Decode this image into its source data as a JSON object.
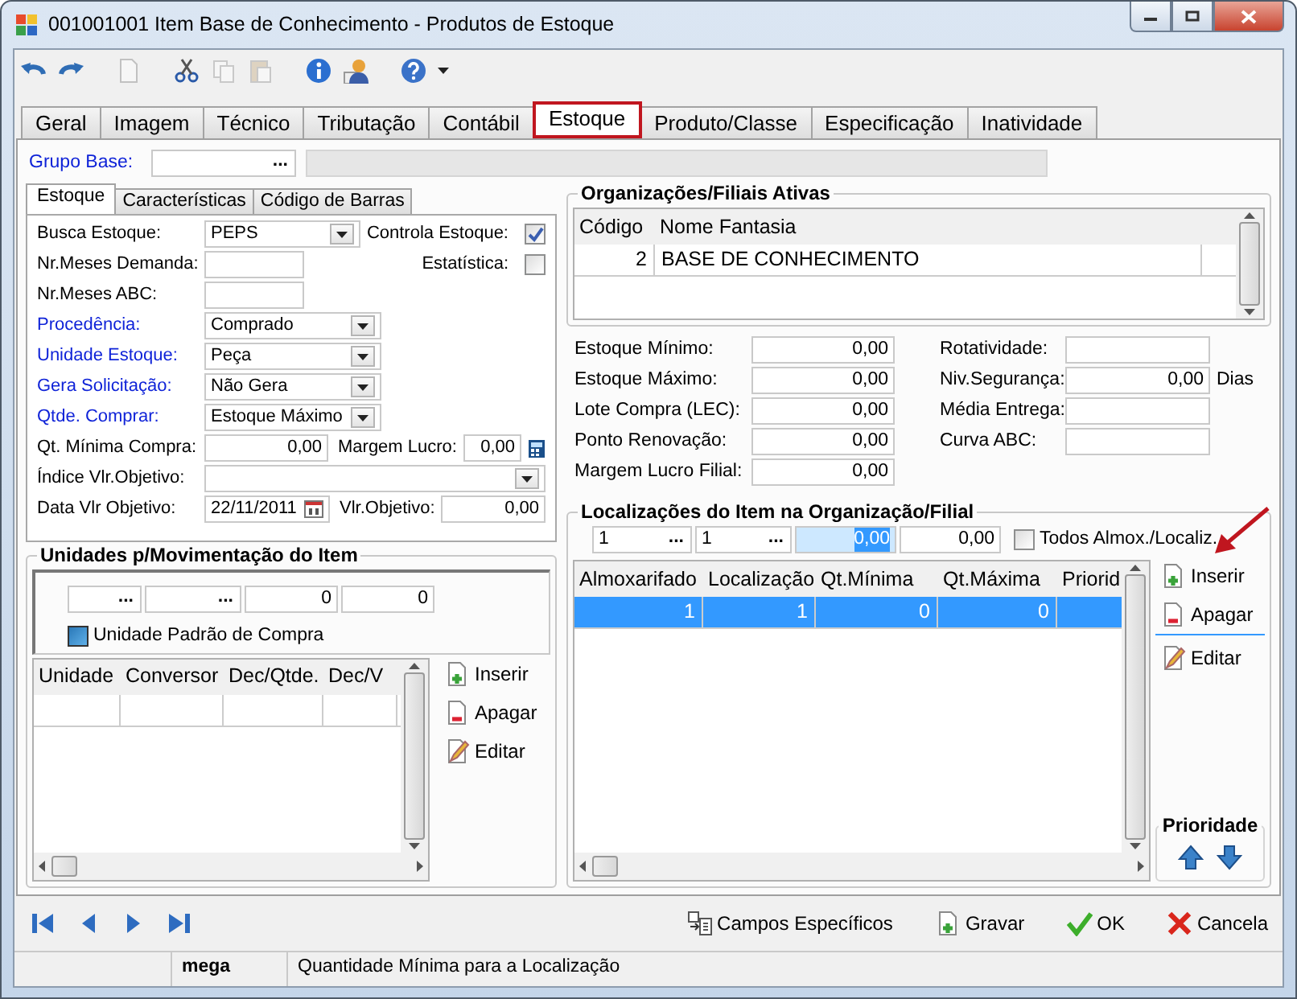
{
  "window": {
    "title": "001001001 Item Base de Conhecimento -  Produtos de Estoque"
  },
  "toolbar": [
    {
      "kind": "undo",
      "disabled": false
    },
    {
      "kind": "redo",
      "disabled": false
    },
    {
      "kind": "sep"
    },
    {
      "kind": "new",
      "disabled": true
    },
    {
      "kind": "sep"
    },
    {
      "kind": "cut",
      "disabled": false
    },
    {
      "kind": "copy",
      "disabled": true
    },
    {
      "kind": "paste",
      "disabled": true
    },
    {
      "kind": "sep"
    },
    {
      "kind": "info",
      "disabled": false
    },
    {
      "kind": "user",
      "disabled": false
    },
    {
      "kind": "sep"
    },
    {
      "kind": "help",
      "disabled": false
    }
  ],
  "tabs": [
    {
      "label": "Geral",
      "selected": false,
      "highlighted": false
    },
    {
      "label": "Imagem",
      "selected": false,
      "highlighted": false
    },
    {
      "label": "Técnico",
      "selected": false,
      "highlighted": false
    },
    {
      "label": "Tributação",
      "selected": false,
      "highlighted": false
    },
    {
      "label": "Contábil",
      "selected": false,
      "highlighted": false
    },
    {
      "label": "Estoque",
      "selected": true,
      "highlighted": true
    },
    {
      "label": "Produto/Classe",
      "selected": false,
      "highlighted": false
    },
    {
      "label": "Especificação",
      "selected": false,
      "highlighted": false
    },
    {
      "label": "Inatividade",
      "selected": false,
      "highlighted": false
    }
  ],
  "grupo_base": {
    "label": "Grupo Base:",
    "required": true,
    "button": "..."
  },
  "left_tabs": [
    {
      "label": "Estoque",
      "selected": true
    },
    {
      "label": "Características",
      "selected": false
    },
    {
      "label": "Código de Barras",
      "selected": false
    }
  ],
  "estoque_rows": [
    [
      {
        "kind": "select",
        "label": "Busca Estoque:",
        "value": "PEPS",
        "required": false
      },
      {
        "kind": "checkbox",
        "label": "Controla Estoque:",
        "checked": true
      }
    ],
    [
      {
        "kind": "text",
        "label": "Nr.Meses Demanda:",
        "required": false
      },
      {
        "kind": "checkbox",
        "label": "Estatística:",
        "checked": false
      }
    ],
    [
      {
        "kind": "text",
        "label": "Nr.Meses ABC:",
        "required": false
      }
    ],
    [
      {
        "kind": "select",
        "label": "Procedência:",
        "value": "Comprado",
        "required": true
      }
    ],
    [
      {
        "kind": "select",
        "label": "Unidade Estoque:",
        "value": "Peça",
        "required": true
      }
    ],
    [
      {
        "kind": "select",
        "label": "Gera Solicitação:",
        "value": "Não Gera",
        "required": true
      }
    ],
    [
      {
        "kind": "select",
        "label": "Qtde. Comprar:",
        "value": "Estoque Máximo",
        "required": true
      }
    ],
    [
      {
        "kind": "number",
        "label": "Qt. Mínima Compra:",
        "value": "0,00",
        "required": false
      },
      {
        "kind": "calc",
        "label": "Margem Lucro:",
        "value": "0,00",
        "required": false
      }
    ],
    [
      {
        "kind": "wide-select",
        "label": "Índice Vlr.Objetivo:",
        "required": false
      }
    ],
    [
      {
        "kind": "date",
        "label": "Data Vlr Objetivo:",
        "value": "22/11/2011",
        "required": false
      },
      {
        "kind": "number",
        "label": "Vlr.Objetivo:",
        "value": "0,00",
        "required": false
      }
    ]
  ],
  "unidades": {
    "title": "Unidades p/Movimentação do Item",
    "inputs": [
      {
        "kind": "lookup",
        "button": "..."
      },
      {
        "kind": "lookup",
        "button": "..."
      },
      {
        "kind": "number",
        "value": "0",
        "focused": false
      },
      {
        "kind": "number",
        "value": "0",
        "focused": false
      }
    ],
    "checkbox": {
      "label": "Unidade Padrão de Compra",
      "checked": true
    },
    "table": {
      "columns": [
        "Unidade",
        "Conversor",
        "Dec/Qtde.",
        "Dec/V"
      ]
    },
    "buttons": [
      {
        "kind": "insert",
        "label": "Inserir",
        "marked": false
      },
      {
        "kind": "delete",
        "label": "Apagar",
        "marked": false
      },
      {
        "kind": "edit",
        "label": "Editar",
        "marked": false
      }
    ]
  },
  "organizacoes": {
    "title": "Organizações/Filiais Ativas",
    "columns": [
      "Código",
      "Nome Fantasia"
    ],
    "rows": [
      {
        "cells": [
          "2",
          "BASE DE CONHECIMENTO"
        ],
        "selected": false
      }
    ]
  },
  "estoque_filial": {
    "left": [
      {
        "label": "Estoque Mínimo:",
        "value": "0,00"
      },
      {
        "label": "Estoque Máximo:",
        "value": "0,00"
      },
      {
        "label": "Lote Compra (LEC):",
        "value": "0,00"
      },
      {
        "label": "Ponto Renovação:",
        "value": "0,00"
      },
      {
        "label": "Margem Lucro Filial:",
        "value": "0,00"
      }
    ],
    "right": [
      {
        "label": "Rotatividade:"
      },
      {
        "label": "Niv.Segurança:",
        "value": "0,00",
        "suffix": "Dias"
      },
      {
        "label": "Média Entrega:"
      },
      {
        "label": "Curva ABC:"
      }
    ]
  },
  "localizacoes": {
    "title": "Localizações do Item na Organização/Filial",
    "inputs": [
      {
        "kind": "lookup",
        "value": "1",
        "button": "..."
      },
      {
        "kind": "lookup",
        "value": "1",
        "button": "..."
      },
      {
        "kind": "number",
        "value": "0,00",
        "focused": true
      },
      {
        "kind": "number",
        "value": "0,00",
        "focused": false
      }
    ],
    "checkbox": {
      "label": "Todos Almox./Localiz.",
      "checked": false
    },
    "table": {
      "columns": [
        "Almoxarifado",
        "Localização",
        "Qt.Mínima",
        "Qt.Máxima",
        "Priorid"
      ],
      "rows": [
        {
          "cells": [
            "1",
            "1",
            "0",
            "0"
          ],
          "selected": true
        }
      ]
    },
    "buttons": [
      {
        "kind": "insert",
        "label": "Inserir",
        "marked": true
      },
      {
        "kind": "delete",
        "label": "Apagar",
        "marked": false
      },
      {
        "kind": "edit",
        "label": "Editar",
        "marked": false
      }
    ],
    "priority": {
      "title": "Prioridade"
    }
  },
  "navigation": [
    {
      "kind": "first"
    },
    {
      "kind": "prev"
    },
    {
      "kind": "next"
    },
    {
      "kind": "last"
    }
  ],
  "actions": [
    {
      "kind": "fields",
      "label": "Campos Específicos"
    },
    {
      "kind": "save",
      "label": "Gravar"
    },
    {
      "kind": "ok",
      "label": "OK"
    },
    {
      "kind": "cancel",
      "label": "Cancela"
    }
  ],
  "status_bar": {
    "user": "mega",
    "message": "Quantidade Mínima para a Localização"
  }
}
